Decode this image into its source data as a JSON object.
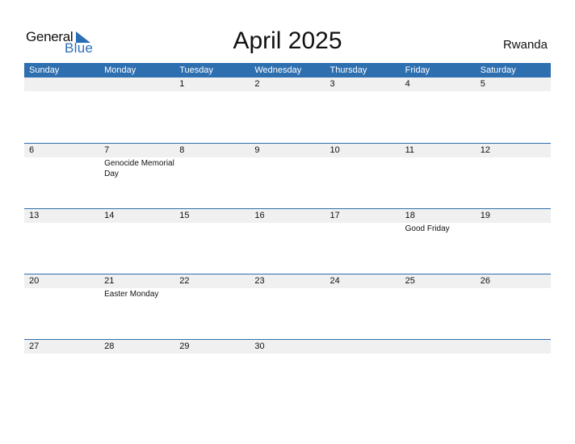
{
  "logo": {
    "general": "General",
    "blue": "Blue",
    "icon": "triangle-flag-icon"
  },
  "title": "April 2025",
  "country": "Rwanda",
  "colors": {
    "accent": "#2e6fb0",
    "strip": "#f0f0f0"
  },
  "weekdays": [
    "Sunday",
    "Monday",
    "Tuesday",
    "Wednesday",
    "Thursday",
    "Friday",
    "Saturday"
  ],
  "weeks": [
    [
      {
        "day": ""
      },
      {
        "day": ""
      },
      {
        "day": "1"
      },
      {
        "day": "2"
      },
      {
        "day": "3"
      },
      {
        "day": "4"
      },
      {
        "day": "5"
      }
    ],
    [
      {
        "day": "6"
      },
      {
        "day": "7",
        "holiday": "Genocide Memorial Day"
      },
      {
        "day": "8"
      },
      {
        "day": "9"
      },
      {
        "day": "10"
      },
      {
        "day": "11"
      },
      {
        "day": "12"
      }
    ],
    [
      {
        "day": "13"
      },
      {
        "day": "14"
      },
      {
        "day": "15"
      },
      {
        "day": "16"
      },
      {
        "day": "17"
      },
      {
        "day": "18",
        "holiday": "Good Friday"
      },
      {
        "day": "19"
      }
    ],
    [
      {
        "day": "20"
      },
      {
        "day": "21",
        "holiday": "Easter Monday"
      },
      {
        "day": "22"
      },
      {
        "day": "23"
      },
      {
        "day": "24"
      },
      {
        "day": "25"
      },
      {
        "day": "26"
      }
    ],
    [
      {
        "day": "27"
      },
      {
        "day": "28"
      },
      {
        "day": "29"
      },
      {
        "day": "30"
      },
      {
        "day": ""
      },
      {
        "day": ""
      },
      {
        "day": ""
      }
    ]
  ]
}
